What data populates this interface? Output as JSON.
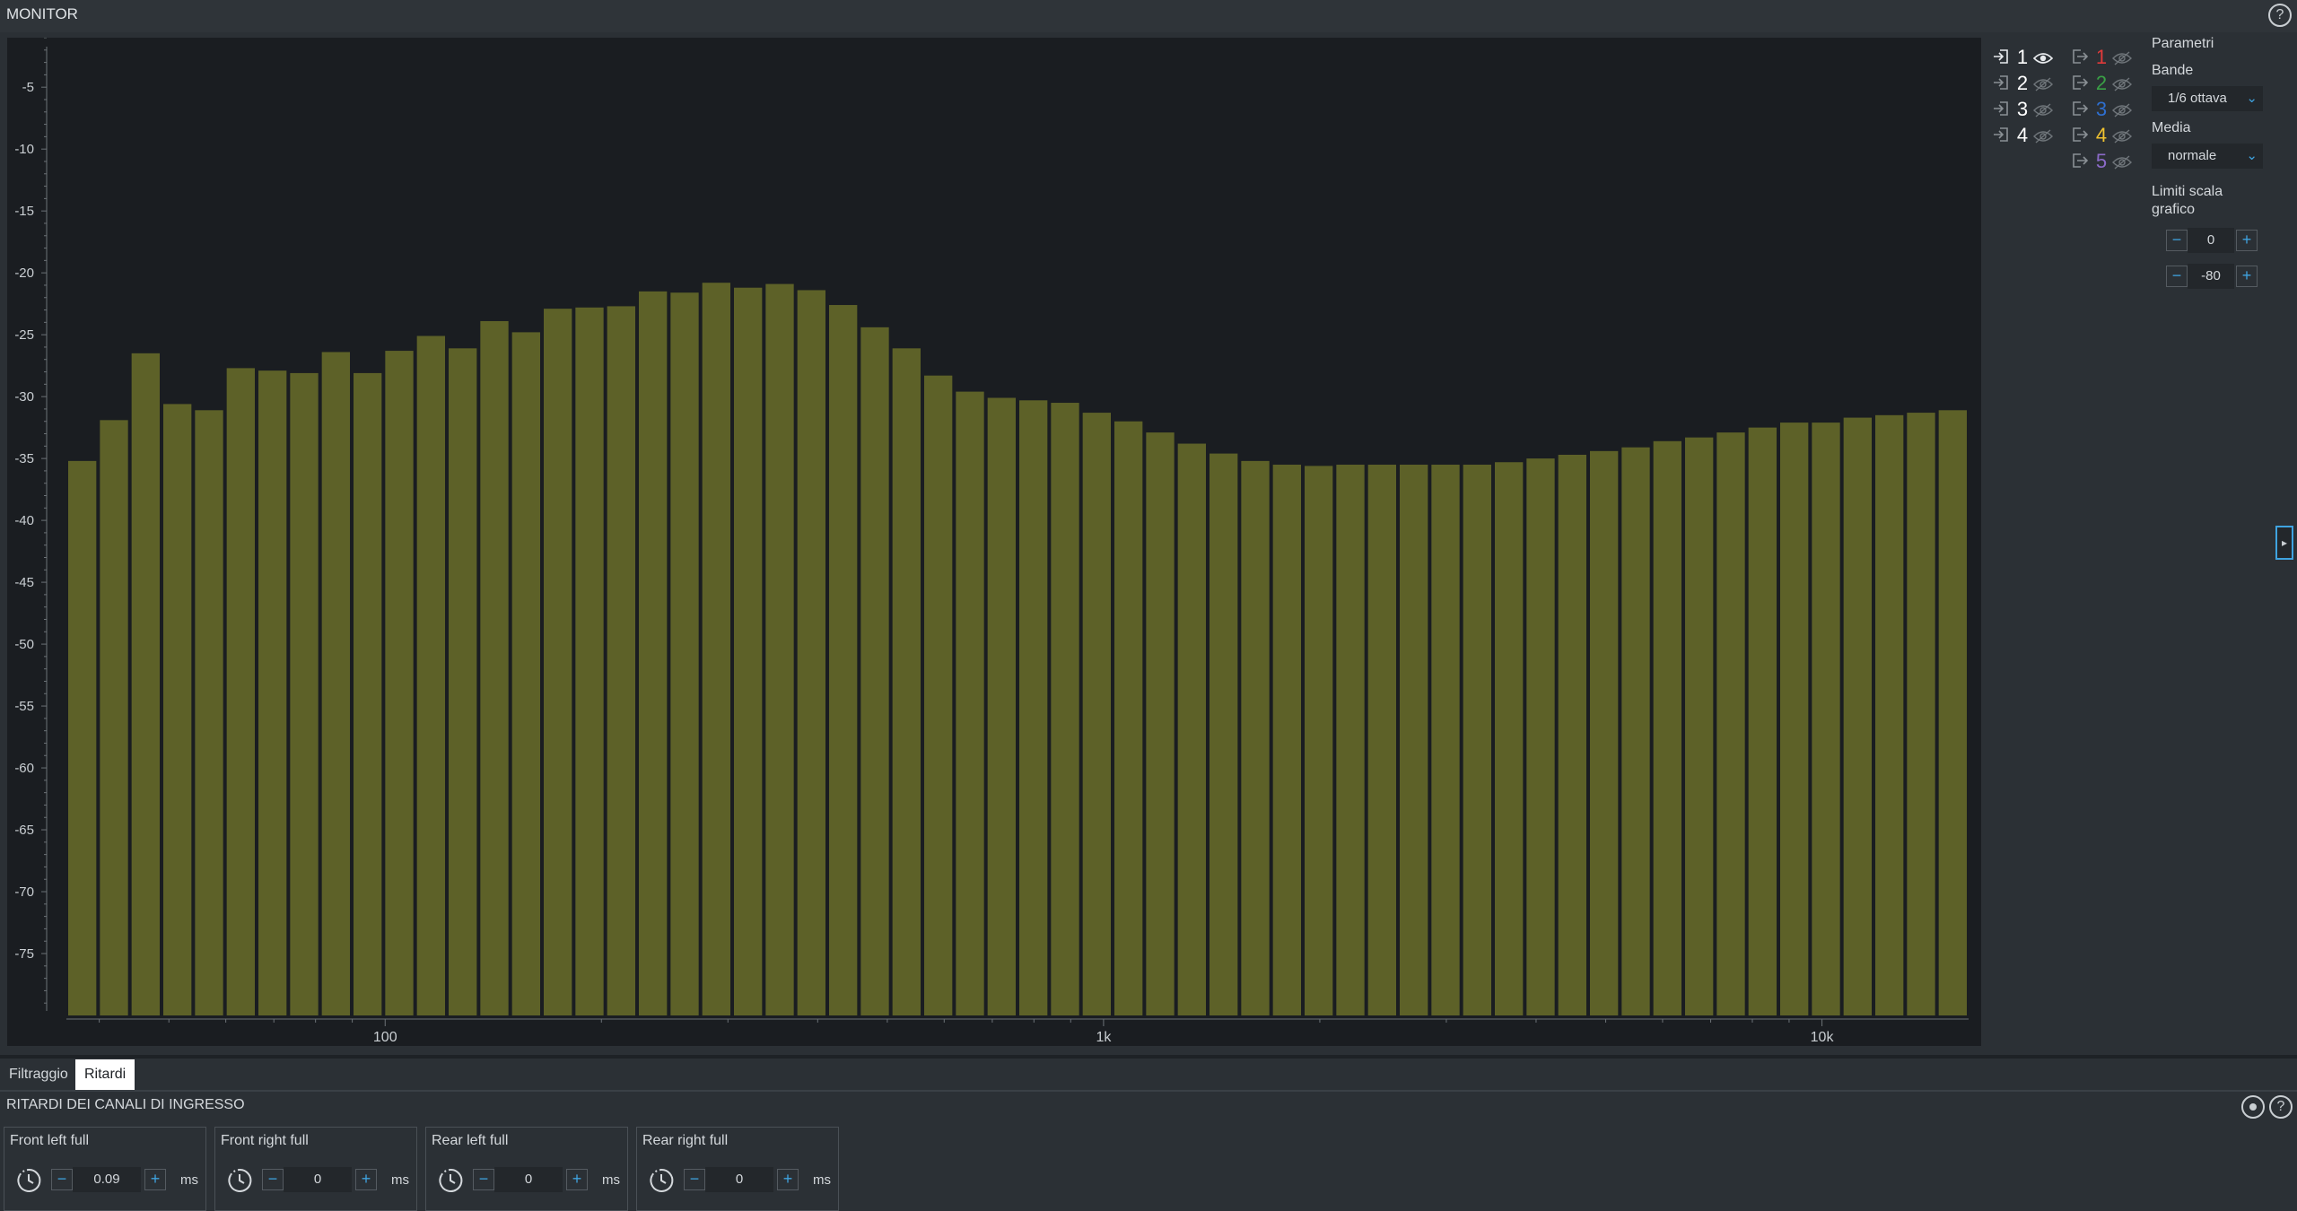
{
  "window": {
    "title": "MONITOR"
  },
  "chart_data": {
    "type": "bar",
    "title": "",
    "xlabel": "",
    "ylabel": "",
    "x_scale": "log",
    "xlim": [
      36,
      16000
    ],
    "ylim": [
      -80,
      -1
    ],
    "y_ticks": [
      -5,
      -10,
      -15,
      -20,
      -25,
      -30,
      -35,
      -40,
      -45,
      -50,
      -55,
      -60,
      -65,
      -70,
      -75
    ],
    "x_tick_labels": [
      {
        "value": 100,
        "label": "100"
      },
      {
        "value": 1000,
        "label": "1k"
      },
      {
        "value": 10000,
        "label": "10k"
      }
    ],
    "bar_color": "#5d6128",
    "grid": false,
    "values": [
      -35.2,
      -31.9,
      -26.5,
      -30.6,
      -31.1,
      -27.7,
      -27.9,
      -28.1,
      -26.4,
      -28.1,
      -26.3,
      -25.1,
      -26.1,
      -23.9,
      -24.8,
      -22.9,
      -22.8,
      -22.7,
      -21.5,
      -21.6,
      -20.8,
      -21.2,
      -20.9,
      -21.4,
      -22.6,
      -24.4,
      -26.1,
      -28.3,
      -29.6,
      -30.1,
      -30.3,
      -30.5,
      -31.3,
      -32.0,
      -32.9,
      -33.8,
      -34.6,
      -35.2,
      -35.5,
      -35.6,
      -35.5,
      -35.5,
      -35.5,
      -35.5,
      -35.5,
      -35.3,
      -35.0,
      -34.7,
      -34.4,
      -34.1,
      -33.6,
      -33.3,
      -32.9,
      -32.5,
      -32.1,
      -32.1,
      -31.7,
      -31.5,
      -31.3,
      -31.1
    ]
  },
  "sidebar": {
    "inputs": [
      {
        "num": "1",
        "visible": true,
        "color": "#ffffff"
      },
      {
        "num": "2",
        "visible": false,
        "color": "#ffffff"
      },
      {
        "num": "3",
        "visible": false,
        "color": "#ffffff"
      },
      {
        "num": "4",
        "visible": false,
        "color": "#ffffff"
      }
    ],
    "outputs": [
      {
        "num": "1",
        "visible": false,
        "color": "#e03a3a"
      },
      {
        "num": "2",
        "visible": false,
        "color": "#3aa046"
      },
      {
        "num": "3",
        "visible": false,
        "color": "#2e6fd0"
      },
      {
        "num": "4",
        "visible": false,
        "color": "#f0c230"
      },
      {
        "num": "5",
        "visible": false,
        "color": "#8b6ac8"
      }
    ],
    "params_label": "Parametri",
    "bands_label": "Bande",
    "bands_value": "1/6 ottava",
    "average_label": "Media",
    "average_value": "normale",
    "scale_label_1": "Limiti scala",
    "scale_label_2": "grafico",
    "scale_max": "0",
    "scale_min": "-80"
  },
  "tabs": [
    "Filtraggio",
    "Ritardi"
  ],
  "active_tab": "Ritardi",
  "delays": {
    "section_title": "RITARDI DEI CANALI DI INGRESSO",
    "unit": "ms",
    "channels": [
      {
        "name": "Front left full",
        "value": "0.09"
      },
      {
        "name": "Front right full",
        "value": "0"
      },
      {
        "name": "Rear left full",
        "value": "0"
      },
      {
        "name": "Rear right full",
        "value": "0"
      }
    ]
  }
}
